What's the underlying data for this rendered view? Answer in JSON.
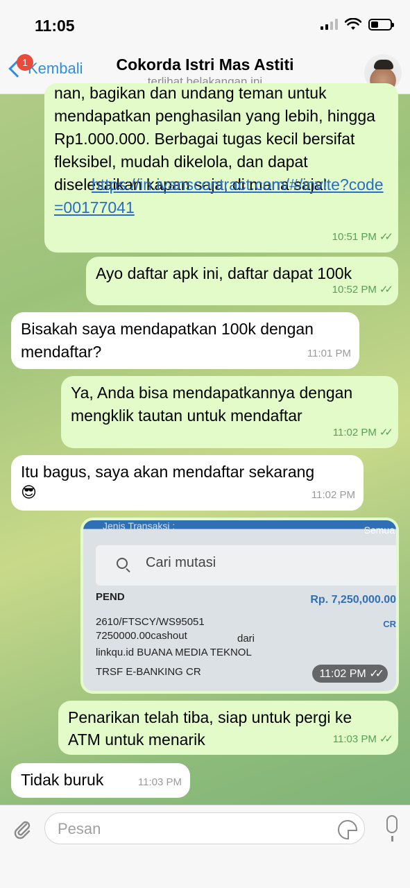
{
  "status_bar": {
    "time": "11:05"
  },
  "header": {
    "back_label": "Kembali",
    "unread_badge": "1",
    "contact_name": "Cokorda Istri Mas Astiti",
    "last_seen": "terlihat belakangan ini"
  },
  "messages": [
    {
      "direction": "out",
      "text_partial_top": "nan, bagikan dan undang teman untuk",
      "text": "mendapatkan penghasilan yang lebih, hingga Rp1.000.000. Berbagai tugas kecil bersifat fleksibel, mudah dikelola, dan dapat diselesaikan kapan saja, di mana saja!",
      "link": "https://in.ivanscontract.com/#/invite?code=00177041",
      "time": "10:51 PM"
    },
    {
      "direction": "out",
      "text": "Ayo daftar apk ini, daftar dapat 100k",
      "time": "10:52 PM"
    },
    {
      "direction": "in",
      "text": "Bisakah saya mendapatkan 100k dengan mendaftar?",
      "time": "11:01 PM"
    },
    {
      "direction": "out",
      "text": "Ya, Anda bisa mendapatkannya dengan mengklik tautan untuk mendaftar",
      "time": "11:02 PM"
    },
    {
      "direction": "in",
      "text": "Itu bagus, saya akan mendaftar sekarang",
      "emoji": "😎",
      "time": "11:02 PM"
    },
    {
      "direction": "out",
      "type": "image",
      "time": "11:02 PM",
      "image_text": {
        "header_left": "Jenis Transaksi :",
        "header_right": "Semua",
        "search_placeholder": "Cari mutasi",
        "status": "PEND",
        "amount": "Rp. 7,250,000.00",
        "cr": "CR",
        "line1": "2610/FTSCY/WS95051",
        "line2": "7250000.00cashout",
        "line2b": "dari",
        "line3": "linkqu.id  BUANA MEDIA TEKNOL",
        "line4": "TRSF E-BANKING CR"
      }
    },
    {
      "direction": "out",
      "text": "Penarikan telah tiba, siap untuk pergi ke ATM untuk menarik",
      "time": "11:03 PM"
    },
    {
      "direction": "in",
      "text": "Tidak buruk",
      "time": "11:03 PM"
    }
  ],
  "input": {
    "placeholder": "Pesan"
  },
  "colors": {
    "outgoing_bubble": "#e2fbc8",
    "incoming_bubble": "#ffffff",
    "accent": "#2f8de4",
    "badge": "#e84a3c"
  }
}
